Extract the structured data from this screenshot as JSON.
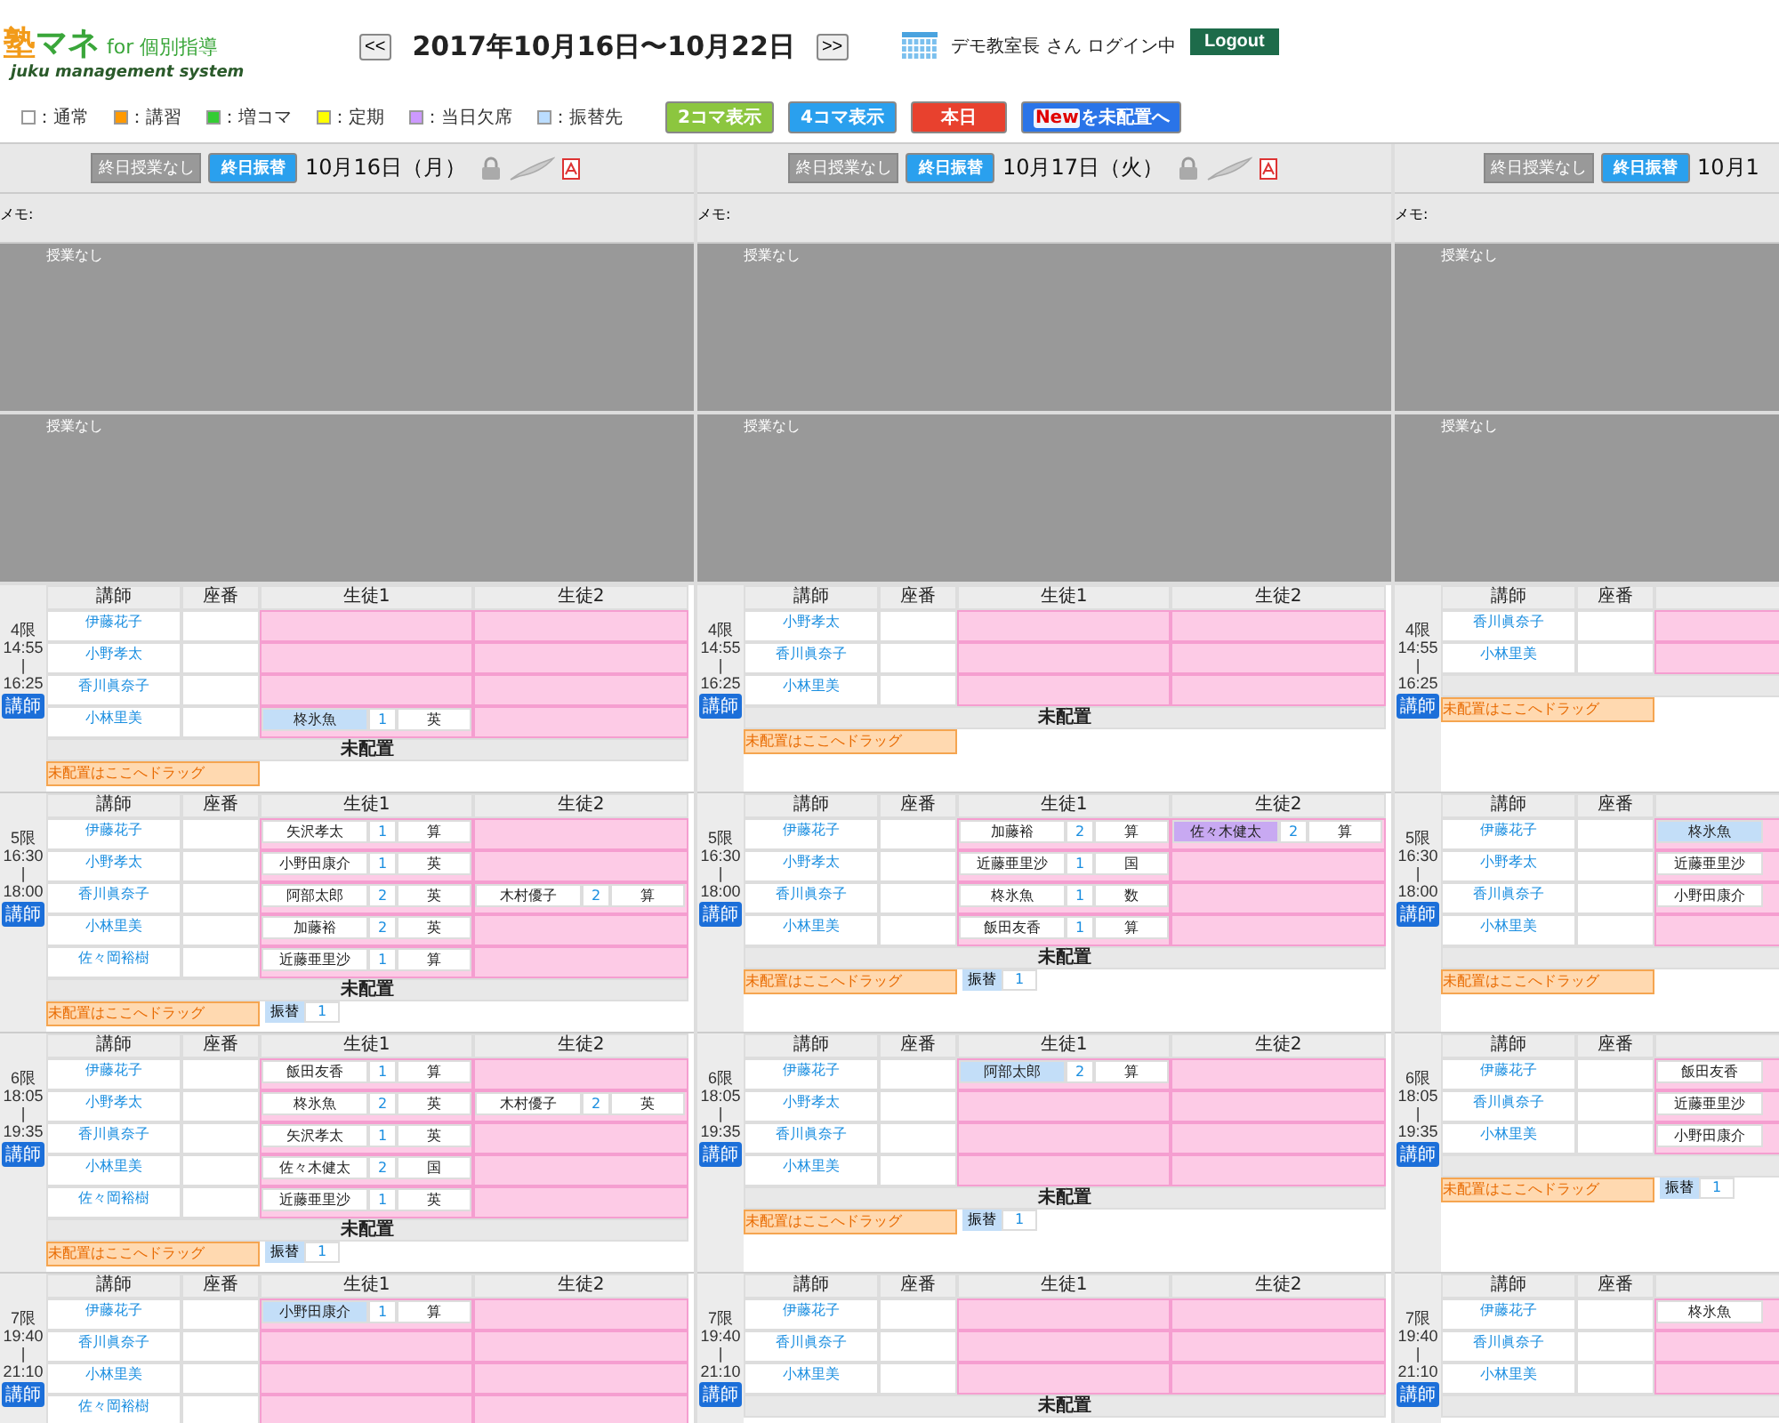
{
  "logo": {
    "main_a": "塾",
    "main_b": "マネ",
    "for": "for 個別指導",
    "sub": "juku management system"
  },
  "nav": {
    "prev": "<<",
    "range": "2017年10月16日〜10月22日",
    "next": ">>",
    "user": "デモ教室長 さん ログイン中",
    "logout": "Logout"
  },
  "legend": [
    {
      "label": "：通常",
      "color": "#ffffff"
    },
    {
      "label": "：講習",
      "color": "#ff9900"
    },
    {
      "label": "：増コマ",
      "color": "#33cc33"
    },
    {
      "label": "：定期",
      "color": "#ffff00"
    },
    {
      "label": "：当日欠席",
      "color": "#cc99ff"
    },
    {
      "label": "：振替先",
      "color": "#bbddff"
    }
  ],
  "view_buttons": [
    {
      "label": "2コマ表示",
      "kind": "green"
    },
    {
      "label": "4コマ表示",
      "kind": "blue"
    },
    {
      "label": "本日",
      "kind": "red"
    },
    {
      "prefix": "New",
      "label": "を未配置へ",
      "kind": "navy"
    }
  ],
  "days": [
    {
      "buttons": [
        {
          "label": "終日授業なし",
          "kind": "gray"
        },
        {
          "label": "終日振替",
          "kind": "blue"
        }
      ],
      "date": "10月16日（月）",
      "tools": true,
      "memo": "メモ:",
      "blocks": [
        "授業なし",
        "授業なし"
      ],
      "periods": [
        {
          "label": "4限",
          "start": "14:55",
          "sep": "|",
          "end": "16:25",
          "badge": "講師",
          "headers": [
            "講師",
            "座番",
            "生徒1",
            "生徒2"
          ],
          "unassigned_title": "未配置",
          "drop_hint": "未配置はここへドラッグ",
          "rows": [
            {
              "teacher": "伊藤花子",
              "slots": [
                {
                  "kind": "empty"
                },
                {
                  "kind": "empty"
                }
              ]
            },
            {
              "teacher": "小野孝太",
              "slots": [
                {
                  "kind": "empty"
                },
                {
                  "kind": "empty"
                }
              ]
            },
            {
              "teacher": "香川眞奈子",
              "slots": [
                {
                  "kind": "empty"
                },
                {
                  "kind": "empty"
                }
              ]
            },
            {
              "teacher": "小林里美",
              "slots": [
                {
                  "kind": "transfer",
                  "name": "柊氷魚",
                  "count": "1",
                  "subject": "英"
                },
                {
                  "kind": "empty"
                }
              ]
            }
          ]
        },
        {
          "label": "5限",
          "start": "16:30",
          "sep": "|",
          "end": "18:00",
          "badge": "講師",
          "headers": [
            "講師",
            "座番",
            "生徒1",
            "生徒2"
          ],
          "unassigned_title": "未配置",
          "drop_hint": "未配置はここへドラッグ",
          "pending": [
            {
              "label": "振替",
              "count": "1"
            }
          ],
          "rows": [
            {
              "teacher": "伊藤花子",
              "slots": [
                {
                  "kind": "normal",
                  "name": "矢沢孝太",
                  "count": "1",
                  "subject": "算"
                },
                {
                  "kind": "empty"
                }
              ]
            },
            {
              "teacher": "小野孝太",
              "slots": [
                {
                  "kind": "normal",
                  "name": "小野田康介",
                  "count": "1",
                  "subject": "英"
                },
                {
                  "kind": "empty"
                }
              ]
            },
            {
              "teacher": "香川眞奈子",
              "slots": [
                {
                  "kind": "normal",
                  "name": "阿部太郎",
                  "count": "2",
                  "subject": "英"
                },
                {
                  "kind": "normal",
                  "name": "木村優子",
                  "count": "2",
                  "subject": "算"
                }
              ]
            },
            {
              "teacher": "小林里美",
              "slots": [
                {
                  "kind": "normal",
                  "name": "加藤裕",
                  "count": "2",
                  "subject": "英"
                },
                {
                  "kind": "empty"
                }
              ]
            },
            {
              "teacher": "佐々岡裕樹",
              "slots": [
                {
                  "kind": "normal",
                  "name": "近藤亜里沙",
                  "count": "1",
                  "subject": "算"
                },
                {
                  "kind": "empty"
                }
              ]
            }
          ]
        },
        {
          "label": "6限",
          "start": "18:05",
          "sep": "|",
          "end": "19:35",
          "badge": "講師",
          "headers": [
            "講師",
            "座番",
            "生徒1",
            "生徒2"
          ],
          "unassigned_title": "未配置",
          "drop_hint": "未配置はここへドラッグ",
          "pending": [
            {
              "label": "振替",
              "count": "1"
            }
          ],
          "rows": [
            {
              "teacher": "伊藤花子",
              "slots": [
                {
                  "kind": "normal",
                  "name": "飯田友香",
                  "count": "1",
                  "subject": "算"
                },
                {
                  "kind": "empty"
                }
              ]
            },
            {
              "teacher": "小野孝太",
              "slots": [
                {
                  "kind": "normal",
                  "name": "柊氷魚",
                  "count": "2",
                  "subject": "英"
                },
                {
                  "kind": "normal",
                  "name": "木村優子",
                  "count": "2",
                  "subject": "英"
                }
              ]
            },
            {
              "teacher": "香川眞奈子",
              "slots": [
                {
                  "kind": "normal",
                  "name": "矢沢孝太",
                  "count": "1",
                  "subject": "英"
                },
                {
                  "kind": "empty"
                }
              ]
            },
            {
              "teacher": "小林里美",
              "slots": [
                {
                  "kind": "normal",
                  "name": "佐々木健太",
                  "count": "2",
                  "subject": "国"
                },
                {
                  "kind": "empty"
                }
              ]
            },
            {
              "teacher": "佐々岡裕樹",
              "slots": [
                {
                  "kind": "normal",
                  "name": "近藤亜里沙",
                  "count": "1",
                  "subject": "英"
                },
                {
                  "kind": "empty"
                }
              ]
            }
          ]
        },
        {
          "label": "7限",
          "start": "19:40",
          "sep": "|",
          "end": "21:10",
          "badge": "講師",
          "headers": [
            "講師",
            "座番",
            "生徒1",
            "生徒2"
          ],
          "rows": [
            {
              "teacher": "伊藤花子",
              "slots": [
                {
                  "kind": "transfer",
                  "name": "小野田康介",
                  "count": "1",
                  "subject": "算"
                },
                {
                  "kind": "empty"
                }
              ]
            },
            {
              "teacher": "香川眞奈子",
              "slots": [
                {
                  "kind": "empty"
                },
                {
                  "kind": "empty"
                }
              ]
            },
            {
              "teacher": "小林里美",
              "slots": [
                {
                  "kind": "empty"
                },
                {
                  "kind": "empty"
                }
              ]
            },
            {
              "teacher": "佐々岡裕樹",
              "slots": [
                {
                  "kind": "empty"
                },
                {
                  "kind": "empty"
                }
              ]
            }
          ]
        }
      ]
    },
    {
      "buttons": [
        {
          "label": "終日授業なし",
          "kind": "gray"
        },
        {
          "label": "終日振替",
          "kind": "blue"
        }
      ],
      "date": "10月17日（火）",
      "tools": true,
      "memo": "メモ:",
      "blocks": [
        "授業なし",
        "授業なし"
      ],
      "periods": [
        {
          "label": "4限",
          "start": "14:55",
          "sep": "|",
          "end": "16:25",
          "badge": "講師",
          "headers": [
            "講師",
            "座番",
            "生徒1",
            "生徒2"
          ],
          "unassigned_title": "未配置",
          "drop_hint": "未配置はここへドラッグ",
          "rows": [
            {
              "teacher": "小野孝太",
              "slots": [
                {
                  "kind": "empty"
                },
                {
                  "kind": "empty"
                }
              ]
            },
            {
              "teacher": "香川眞奈子",
              "slots": [
                {
                  "kind": "empty"
                },
                {
                  "kind": "empty"
                }
              ]
            },
            {
              "teacher": "小林里美",
              "slots": [
                {
                  "kind": "empty"
                },
                {
                  "kind": "empty"
                }
              ]
            }
          ]
        },
        {
          "label": "5限",
          "start": "16:30",
          "sep": "|",
          "end": "18:00",
          "badge": "講師",
          "headers": [
            "講師",
            "座番",
            "生徒1",
            "生徒2"
          ],
          "unassigned_title": "未配置",
          "drop_hint": "未配置はここへドラッグ",
          "pending": [
            {
              "label": "振替",
              "count": "1"
            }
          ],
          "rows": [
            {
              "teacher": "伊藤花子",
              "slots": [
                {
                  "kind": "normal",
                  "name": "加藤裕",
                  "count": "2",
                  "subject": "算"
                },
                {
                  "kind": "absent",
                  "name": "佐々木健太",
                  "count": "2",
                  "subject": "算"
                }
              ]
            },
            {
              "teacher": "小野孝太",
              "slots": [
                {
                  "kind": "normal",
                  "name": "近藤亜里沙",
                  "count": "1",
                  "subject": "国"
                },
                {
                  "kind": "empty"
                }
              ]
            },
            {
              "teacher": "香川眞奈子",
              "slots": [
                {
                  "kind": "normal",
                  "name": "柊氷魚",
                  "count": "1",
                  "subject": "数"
                },
                {
                  "kind": "empty"
                }
              ]
            },
            {
              "teacher": "小林里美",
              "slots": [
                {
                  "kind": "normal",
                  "name": "飯田友香",
                  "count": "1",
                  "subject": "算"
                },
                {
                  "kind": "empty"
                }
              ]
            }
          ]
        },
        {
          "label": "6限",
          "start": "18:05",
          "sep": "|",
          "end": "19:35",
          "badge": "講師",
          "headers": [
            "講師",
            "座番",
            "生徒1",
            "生徒2"
          ],
          "unassigned_title": "未配置",
          "drop_hint": "未配置はここへドラッグ",
          "pending": [
            {
              "label": "振替",
              "count": "1"
            }
          ],
          "rows": [
            {
              "teacher": "伊藤花子",
              "slots": [
                {
                  "kind": "transfer",
                  "name": "阿部太郎",
                  "count": "2",
                  "subject": "算"
                },
                {
                  "kind": "empty"
                }
              ]
            },
            {
              "teacher": "小野孝太",
              "slots": [
                {
                  "kind": "empty"
                },
                {
                  "kind": "empty"
                }
              ]
            },
            {
              "teacher": "香川眞奈子",
              "slots": [
                {
                  "kind": "empty"
                },
                {
                  "kind": "empty"
                }
              ]
            },
            {
              "teacher": "小林里美",
              "slots": [
                {
                  "kind": "empty"
                },
                {
                  "kind": "empty"
                }
              ]
            }
          ]
        },
        {
          "label": "7限",
          "start": "19:40",
          "sep": "|",
          "end": "21:10",
          "badge": "講師",
          "headers": [
            "講師",
            "座番",
            "生徒1",
            "生徒2"
          ],
          "unassigned_title": "未配置",
          "rows": [
            {
              "teacher": "伊藤花子",
              "slots": [
                {
                  "kind": "empty"
                },
                {
                  "kind": "empty"
                }
              ]
            },
            {
              "teacher": "香川眞奈子",
              "slots": [
                {
                  "kind": "empty"
                },
                {
                  "kind": "empty"
                }
              ]
            },
            {
              "teacher": "小林里美",
              "slots": [
                {
                  "kind": "empty"
                },
                {
                  "kind": "empty"
                }
              ]
            }
          ]
        }
      ]
    },
    {
      "buttons": [
        {
          "label": "終日授業なし",
          "kind": "gray"
        },
        {
          "label": "終日振替",
          "kind": "blue"
        }
      ],
      "date": "10月1",
      "tools": false,
      "memo": "メモ:",
      "blocks": [
        "授業なし",
        "授業なし"
      ],
      "periods": [
        {
          "label": "4限",
          "start": "14:55",
          "sep": "|",
          "end": "16:25",
          "badge": "講師",
          "headers": [
            "講師",
            "座番"
          ],
          "drop_hint": "未配置はここへドラッグ",
          "rows": [
            {
              "teacher": "香川眞奈子",
              "slots": [
                {
                  "kind": "empty"
                }
              ]
            },
            {
              "teacher": "小林里美",
              "slots": [
                {
                  "kind": "empty"
                }
              ]
            }
          ]
        },
        {
          "label": "5限",
          "start": "16:30",
          "sep": "|",
          "end": "18:00",
          "badge": "講師",
          "headers": [
            "講師",
            "座番"
          ],
          "drop_hint": "未配置はここへドラッグ",
          "rows": [
            {
              "teacher": "伊藤花子",
              "slots": [
                {
                  "kind": "transfer",
                  "name": "柊氷魚"
                }
              ]
            },
            {
              "teacher": "小野孝太",
              "slots": [
                {
                  "kind": "normal",
                  "name": "近藤亜里沙"
                }
              ]
            },
            {
              "teacher": "香川眞奈子",
              "slots": [
                {
                  "kind": "normal",
                  "name": "小野田康介"
                }
              ]
            },
            {
              "teacher": "小林里美",
              "slots": [
                {
                  "kind": "empty"
                }
              ]
            }
          ]
        },
        {
          "label": "6限",
          "start": "18:05",
          "sep": "|",
          "end": "19:35",
          "badge": "講師",
          "headers": [
            "講師",
            "座番"
          ],
          "drop_hint": "未配置はここへドラッグ",
          "pending": [
            {
              "label": "振替",
              "count": "1"
            }
          ],
          "rows": [
            {
              "teacher": "伊藤花子",
              "slots": [
                {
                  "kind": "normal",
                  "name": "飯田友香"
                }
              ]
            },
            {
              "teacher": "香川眞奈子",
              "slots": [
                {
                  "kind": "normal",
                  "name": "近藤亜里沙"
                }
              ]
            },
            {
              "teacher": "小林里美",
              "slots": [
                {
                  "kind": "normal",
                  "name": "小野田康介"
                }
              ]
            }
          ]
        },
        {
          "label": "7限",
          "start": "19:40",
          "sep": "|",
          "end": "21:10",
          "badge": "講師",
          "headers": [
            "講師",
            "座番"
          ],
          "rows": [
            {
              "teacher": "伊藤花子",
              "slots": [
                {
                  "kind": "normal",
                  "name": "柊氷魚"
                }
              ]
            },
            {
              "teacher": "香川眞奈子",
              "slots": [
                {
                  "kind": "empty"
                }
              ]
            },
            {
              "teacher": "小林里美",
              "slots": [
                {
                  "kind": "empty"
                }
              ]
            }
          ]
        }
      ]
    }
  ]
}
